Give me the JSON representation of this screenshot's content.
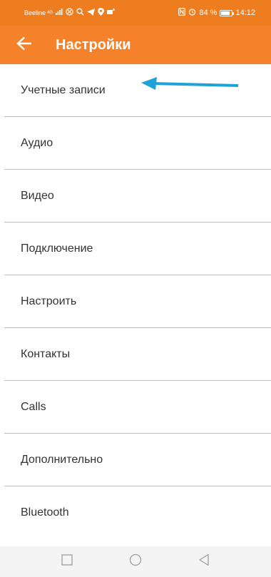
{
  "status_bar": {
    "carrier": "Beeline",
    "network": "4G",
    "battery_percent": "84 %",
    "time": "14:12",
    "battery_level": 0.84
  },
  "header": {
    "title": "Настройки",
    "back_icon": "arrow-left-icon"
  },
  "settings": {
    "items": [
      {
        "label": "Учетные записи"
      },
      {
        "label": "Аудио"
      },
      {
        "label": "Видео"
      },
      {
        "label": "Подключение"
      },
      {
        "label": "Настроить"
      },
      {
        "label": "Контакты"
      },
      {
        "label": "Calls"
      },
      {
        "label": "Дополнительно"
      },
      {
        "label": "Bluetooth"
      }
    ]
  },
  "annotation": {
    "arrow_color": "#1fa2d6",
    "target": "Учетные записи"
  },
  "colors": {
    "accent": "#f5822a",
    "status_bar": "#ee7d1f",
    "divider": "#bdbdbd",
    "nav_bar": "#f4f4f4"
  },
  "nav_bar": {
    "icons": [
      "square-icon",
      "circle-icon",
      "triangle-back-icon"
    ]
  }
}
